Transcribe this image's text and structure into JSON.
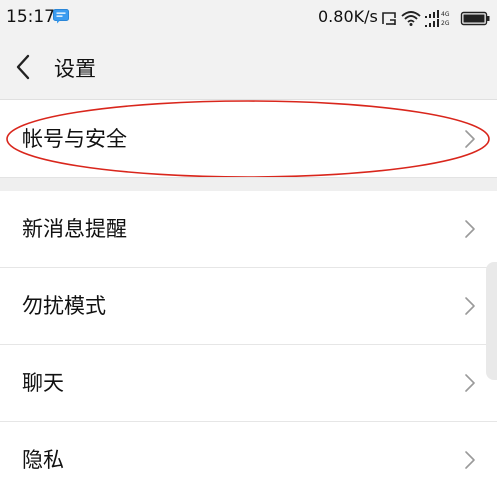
{
  "status_bar": {
    "time": "15:17",
    "net_speed": "0.80K/s",
    "icons": [
      "message-notification-icon",
      "hd-icon",
      "wifi-icon",
      "signal-4g-icon",
      "signal-2g-icon",
      "battery-icon"
    ]
  },
  "header": {
    "title": "设置",
    "back_icon": "chevron-left-icon"
  },
  "settings": {
    "items": [
      {
        "label": "帐号与安全",
        "highlighted": true
      },
      {
        "label": "新消息提醒"
      },
      {
        "label": "勿扰模式"
      },
      {
        "label": "聊天"
      },
      {
        "label": "隐私"
      }
    ]
  },
  "colors": {
    "highlight_ellipse": "#d9261c",
    "chevron": "#9a9a9a",
    "background_bar": "#f2f2f2"
  }
}
